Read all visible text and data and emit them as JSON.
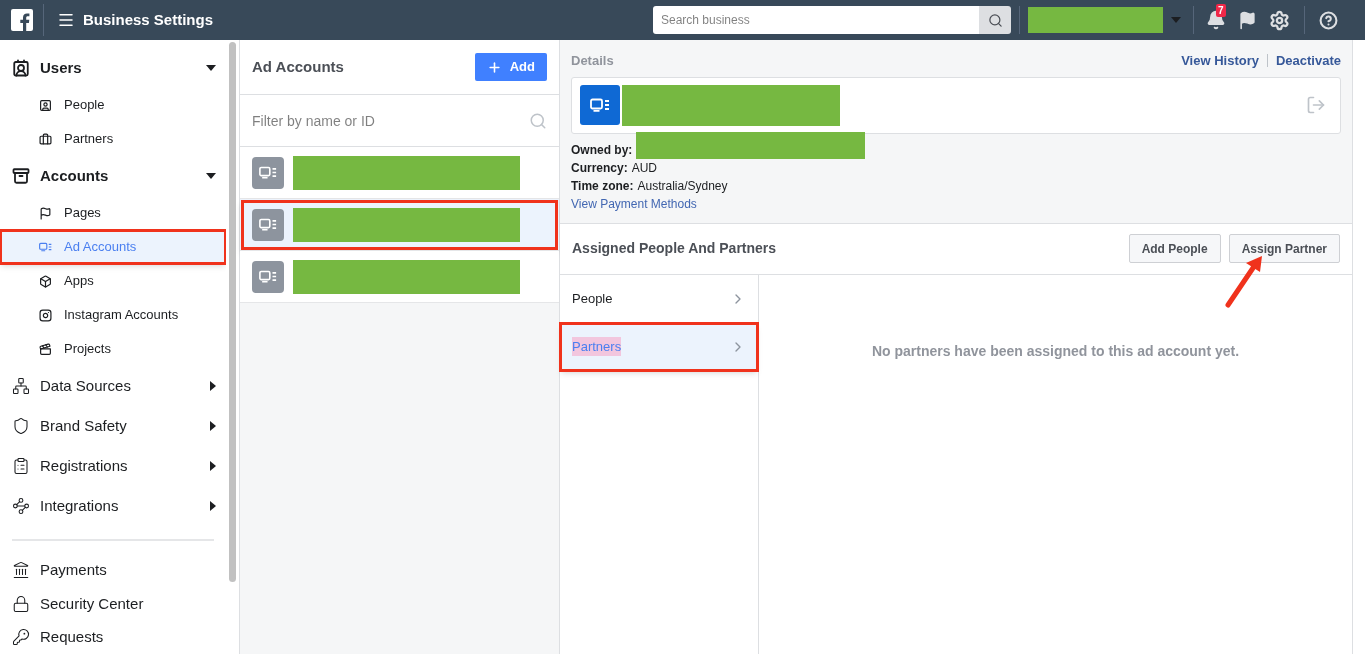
{
  "topbar": {
    "title": "Business Settings",
    "search": {
      "placeholder": "Search business"
    },
    "notification_count": "7"
  },
  "sidebar": {
    "sections": [
      {
        "kind": "group",
        "label": "Users",
        "expanded": true,
        "children": [
          {
            "label": "People",
            "selected": false,
            "highlighted": false
          },
          {
            "label": "Partners",
            "selected": false,
            "highlighted": false
          }
        ]
      },
      {
        "kind": "group",
        "label": "Accounts",
        "expanded": true,
        "children": [
          {
            "label": "Pages",
            "selected": false,
            "highlighted": false
          },
          {
            "label": "Ad Accounts",
            "selected": true,
            "highlighted": true
          },
          {
            "label": "Apps",
            "selected": false,
            "highlighted": false
          },
          {
            "label": "Instagram Accounts",
            "selected": false,
            "highlighted": false
          },
          {
            "label": "Projects",
            "selected": false,
            "highlighted": false
          }
        ]
      },
      {
        "kind": "group",
        "label": "Data Sources",
        "expanded": false
      },
      {
        "kind": "group",
        "label": "Brand Safety",
        "expanded": false
      },
      {
        "kind": "group",
        "label": "Registrations",
        "expanded": false
      },
      {
        "kind": "group",
        "label": "Integrations",
        "expanded": false
      },
      {
        "kind": "divider"
      },
      {
        "kind": "link",
        "label": "Payments"
      },
      {
        "kind": "link",
        "label": "Security Center"
      },
      {
        "kind": "link",
        "label": "Requests"
      }
    ]
  },
  "ad_accounts": {
    "title": "Ad Accounts",
    "add_button": "Add",
    "filter": {
      "placeholder": "Filter by name or ID"
    },
    "rows": [
      {
        "selected": false,
        "highlighted": false
      },
      {
        "selected": true,
        "highlighted": true
      },
      {
        "selected": false,
        "highlighted": false
      }
    ]
  },
  "details": {
    "heading": "Details",
    "links": [
      "View History",
      "Deactivate"
    ],
    "fields": [
      {
        "label": "Owned by:",
        "kind": "redacted"
      },
      {
        "label": "Currency:",
        "kind": "text",
        "value": "AUD"
      },
      {
        "label": "Time zone:",
        "kind": "text",
        "value": "Australia/Sydney"
      }
    ],
    "payment_link": "View Payment Methods",
    "assigned": {
      "title": "Assigned People And Partners",
      "buttons": [
        "Add People",
        "Assign Partner"
      ],
      "annotation_arrow": true,
      "tabs": [
        {
          "label": "People",
          "selected": false,
          "highlighted": false
        },
        {
          "label": "Partners",
          "selected": true,
          "highlighted": true
        }
      ],
      "empty_message": "No partners have been assigned to this ad account yet."
    }
  }
}
